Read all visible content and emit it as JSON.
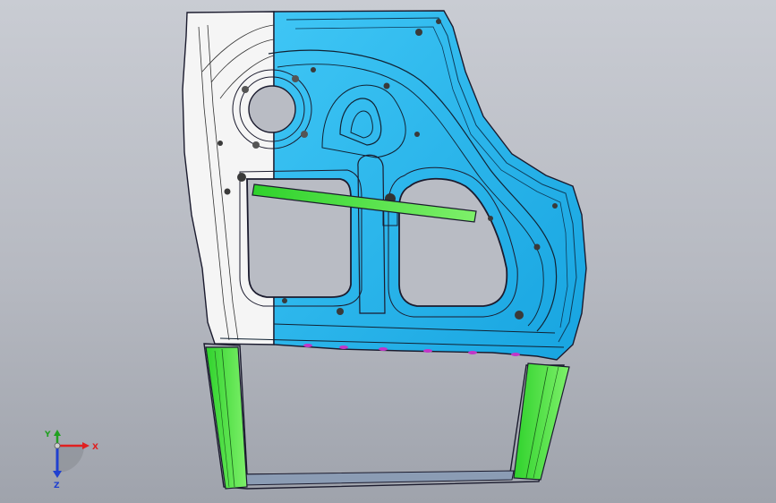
{
  "triad": {
    "x_label": "X",
    "y_label": "Y",
    "z_label": "Z"
  },
  "colors": {
    "background": "#b9bcc4",
    "panel_blue": "#21b6ee",
    "panel_white": "#f4f4f4",
    "beam_green": "#3fe039",
    "outline": "#1b1b2e",
    "accent_magenta": "#c236c8",
    "axis_x": "#e02020",
    "axis_y": "#20a020",
    "axis_z": "#2040d0"
  }
}
